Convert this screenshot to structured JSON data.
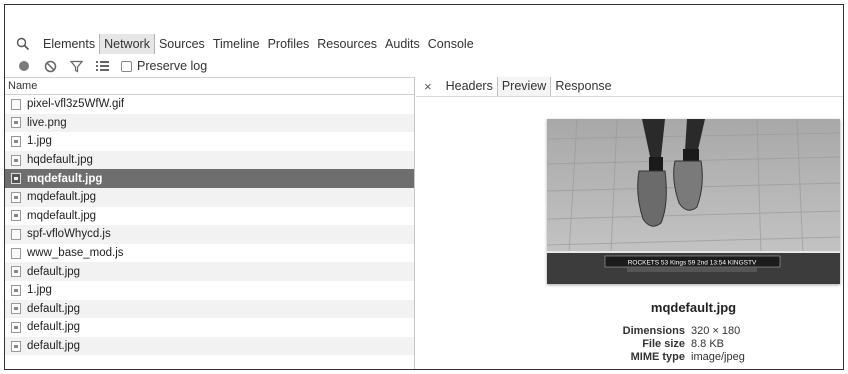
{
  "tabs": [
    "Elements",
    "Network",
    "Sources",
    "Timeline",
    "Profiles",
    "Resources",
    "Audits",
    "Console"
  ],
  "active_tab": "Network",
  "toolbar": {
    "preserve_log_label": "Preserve log",
    "preserve_log_checked": false
  },
  "requests": {
    "column_name": "Name",
    "items": [
      {
        "name": "pixel-vfl3z5WfW.gif",
        "icon": "blank-file-icon"
      },
      {
        "name": "live.png",
        "icon": "image-file-icon"
      },
      {
        "name": "1.jpg",
        "icon": "image-file-icon"
      },
      {
        "name": "hqdefault.jpg",
        "icon": "image-file-icon"
      },
      {
        "name": "mqdefault.jpg",
        "icon": "image-file-icon",
        "selected": true
      },
      {
        "name": "mqdefault.jpg",
        "icon": "image-file-icon"
      },
      {
        "name": "mqdefault.jpg",
        "icon": "image-file-icon"
      },
      {
        "name": "spf-vfloWhycd.js",
        "icon": "blank-file-icon"
      },
      {
        "name": "www_base_mod.js",
        "icon": "blank-file-icon"
      },
      {
        "name": "default.jpg",
        "icon": "image-file-icon"
      },
      {
        "name": "1.jpg",
        "icon": "image-file-icon"
      },
      {
        "name": "default.jpg",
        "icon": "image-file-icon"
      },
      {
        "name": "default.jpg",
        "icon": "image-file-icon"
      },
      {
        "name": "default.jpg",
        "icon": "image-file-icon"
      }
    ]
  },
  "detail": {
    "tabs": [
      "Headers",
      "Preview",
      "Response"
    ],
    "active_tab": "Preview",
    "close_glyph": "×",
    "preview_filename": "mqdefault.jpg",
    "scoreboard_text": "ROCKETS 53 Kings 59 2nd 13:54 KINGSTV",
    "meta": {
      "dimensions_label": "Dimensions",
      "dimensions_value": "320 × 180",
      "filesize_label": "File size",
      "filesize_value": "8.8 KB",
      "mime_label": "MIME type",
      "mime_value": "image/jpeg"
    }
  },
  "colors": {
    "selected_row": "#6e6e6e",
    "active_tab_bg": "#e6e6e6"
  }
}
